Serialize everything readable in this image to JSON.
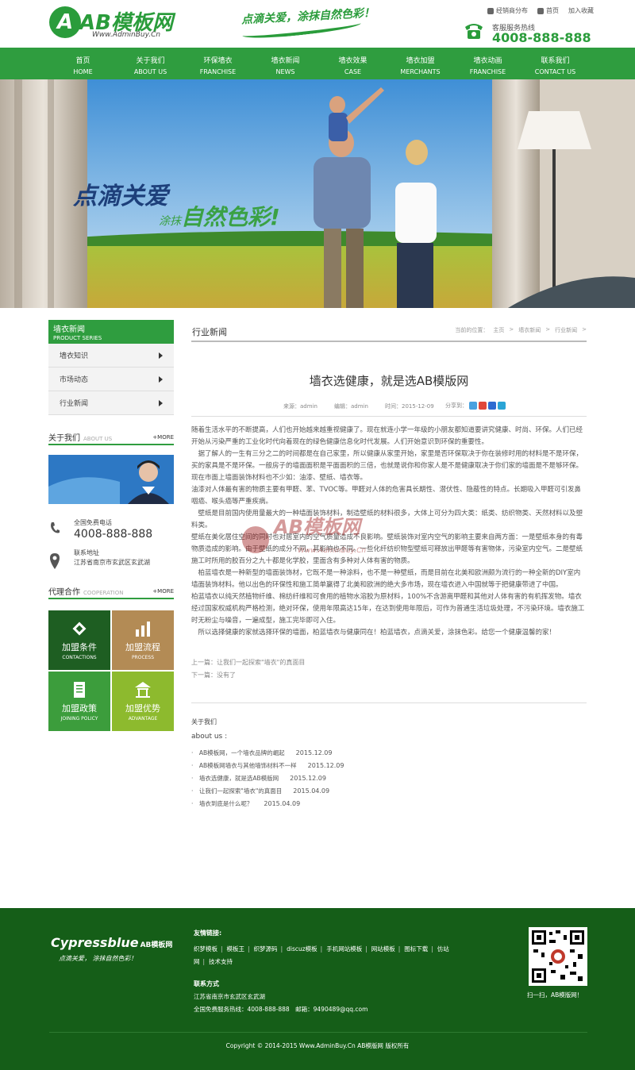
{
  "header": {
    "logo_text": "AB模板网",
    "logo_url": "Www.AdminBuy.Cn",
    "slogan": "点滴关爱，涂抹自然色彩！",
    "top_links": [
      "经销商分布",
      "首页",
      "加入收藏"
    ],
    "hotline_label": "客服服务热线",
    "hotline_number": "4008-888-888"
  },
  "nav": [
    {
      "cn": "首页",
      "en": "HOME"
    },
    {
      "cn": "关于我们",
      "en": "ABOUT US"
    },
    {
      "cn": "环保墙衣",
      "en": "FRANCHISE"
    },
    {
      "cn": "墙衣新闻",
      "en": "NEWS"
    },
    {
      "cn": "墙衣效果",
      "en": "CASE"
    },
    {
      "cn": "墙衣加盟",
      "en": "MERCHANTS"
    },
    {
      "cn": "墙衣动画",
      "en": "FRANCHISE"
    },
    {
      "cn": "联系我们",
      "en": "CONTACT US"
    }
  ],
  "banner": {
    "line1": "点滴关爱",
    "line2_small": "涂抹",
    "line2_big": "自然色彩!"
  },
  "sidebar": {
    "title_cn": "墙衣新闻",
    "title_en": "PRODUCT SERIES",
    "items": [
      "墙衣知识",
      "市场动态",
      "行业新闻"
    ],
    "about_title": "关于我们",
    "about_en": "ABOUT US",
    "more": "+MORE",
    "contact_tel_label": "全国免费电话",
    "contact_tel": "4008-888-888",
    "contact_addr_label": "联系地址",
    "contact_addr": "江苏省南京市玄武区玄武湖",
    "coop_title": "代理合作",
    "coop_en": "COOPERATION",
    "tiles": [
      {
        "cn": "加盟条件",
        "en": "CONTACTIONS",
        "color": "#1e5e22"
      },
      {
        "cn": "加盟流程",
        "en": "PROCESS",
        "color": "#b38b55"
      },
      {
        "cn": "加盟政策",
        "en": "JOINING POLICY",
        "color": "#3c9d3c"
      },
      {
        "cn": "加盟优势",
        "en": "ADVANTAGE",
        "color": "#8dba2e"
      }
    ]
  },
  "main": {
    "section_title": "行业新闻",
    "breadcrumb": [
      "当前的位置：",
      "主页",
      ">",
      "墙衣新闻",
      ">",
      "行业新闻",
      ">"
    ],
    "article_title": "墙衣选健康，就是选AB模版网",
    "meta_source": "来源：admin",
    "meta_editor": "编辑：admin",
    "meta_time": "时间：2015-12-09",
    "share_label": "分享到：",
    "paragraphs": [
      "随着生活水平的不断提高，人们也开始越来越重视健康了。现在就连小学一年级的小朋友都知道要讲究健康、时尚、环保。人们已经开始从污染严重的工业化时代向着现在的绿色健康信息化时代发展。人们开始意识到环保的重要性。",
      "　据了解人的一生有三分之二的时间都是在自己家里，所以健康从家里开始，家里是否环保取决于你在装修时用的材料是不是环保，买的家具是不是环保。一般房子的墙面面积是平面面积的三倍，也就是说你和你家人是不是健康取决于你们家的墙面是不是够环保。现在市面上墙面装饰材料也不少如：油漆、壁纸、墙衣等。",
      "油漆对人体最有害的物质主要有甲醛、苯、TVOC等。甲醛对人体的危害具长期性、潜伏性、隐蔽性的特点。长期吸入甲醛可引发鼻咽癌、喉头癌等严重疾病。",
      "　壁纸是目前国内使用量最大的一种墙面装饰材料，制造壁纸的材料很多，大体上可分为四大类：纸类、纺织物类、天然材料以及塑料类。",
      "壁纸在美化居住空间的同时也对居室内的空气质量造成不良影响。壁纸装饰对室内空气的影响主要来自两方面：一是壁纸本身的有毒物质造成的影响。由于壁纸的成分不同，其影响也不同。一些化纤纺织物型壁纸可释放出甲醛等有害物体，污染室内空气。二是壁纸施工时所用的胶百分之九十都是化学胶，里面含有多种对人体有害的物质。",
      "　柏蓝墙衣是一种新型的墙面装饰材，它既不是一种涂料，也不是一种壁纸，而是目前在北美和欧洲颇为流行的一种全新的DIY室内墙面装饰材料。他以出色的环保性和施工简单赢得了北美和欧洲的绝大多市场，现在墙衣进入中国就等于把健康带进了中国。",
      "柏蓝墙衣以纯天然植物纤维、棉纺纤维和可食用的植物水溶胶为原材料，100%不含游离甲醛和其他对人体有害的有机挥发物。墙衣经过国家权威机构严格检测，绝对环保，使用年限高达15年，在达到使用年限后，可作为普通生活垃圾处理，不污染环境。墙衣施工时无粉尘与噪音，一遍成型，施工完毕即可入住。",
      "　所以选择健康的家就选择环保的墙面，柏蓝墙衣与健康同在！柏蓝墙衣，点滴关爱，涂抹色彩。给您一个健康温馨的家！"
    ],
    "watermark_text": "AB模板网",
    "watermark_url": "Www.AdminBuy.Cn",
    "prev": "上一篇：让我们一起探索\"墙衣\"的真面目",
    "next": "下一篇：没有了",
    "related_title": "关于我们",
    "related_about": "about us :",
    "related": [
      {
        "title": "AB模板网，一个墙衣品牌的崛起",
        "date": "2015.12.09"
      },
      {
        "title": "AB模板网墙衣与其他墙饰材料不一样",
        "date": "2015.12.09"
      },
      {
        "title": "墙衣选健康，就是选AB模版网",
        "date": "2015.12.09"
      },
      {
        "title": "让我们一起探索\"墙衣\"的真面目",
        "date": "2015.04.09"
      },
      {
        "title": "墙衣到底是什么呢？",
        "date": "2015.04.09"
      }
    ]
  },
  "footer": {
    "logo": "Cypressblue",
    "logo_ab": "AB模板网",
    "slogan": "点滴关爱， 涂抹自然色彩！",
    "links_title": "友情链接:",
    "links": [
      "织梦模板",
      "模板王",
      "织梦源码",
      "discuz模板",
      "手机网站模板",
      "网站模板",
      "图标下载",
      "仿站网",
      "技术支持"
    ],
    "contact_title": "联系方式",
    "address": "江苏省南京市玄武区玄武湖",
    "tel": "全国免费服务热线：4008-888-888　邮箱：9490489@qq.com",
    "qr_caption": "扫一扫，AB模版网！",
    "copyright": "Copyright © 2014-2015 Www.AdminBuy.Cn AB模版网 版权所有"
  },
  "colors": {
    "brand_green": "#2f9d3f",
    "footer_green": "#155e18"
  }
}
